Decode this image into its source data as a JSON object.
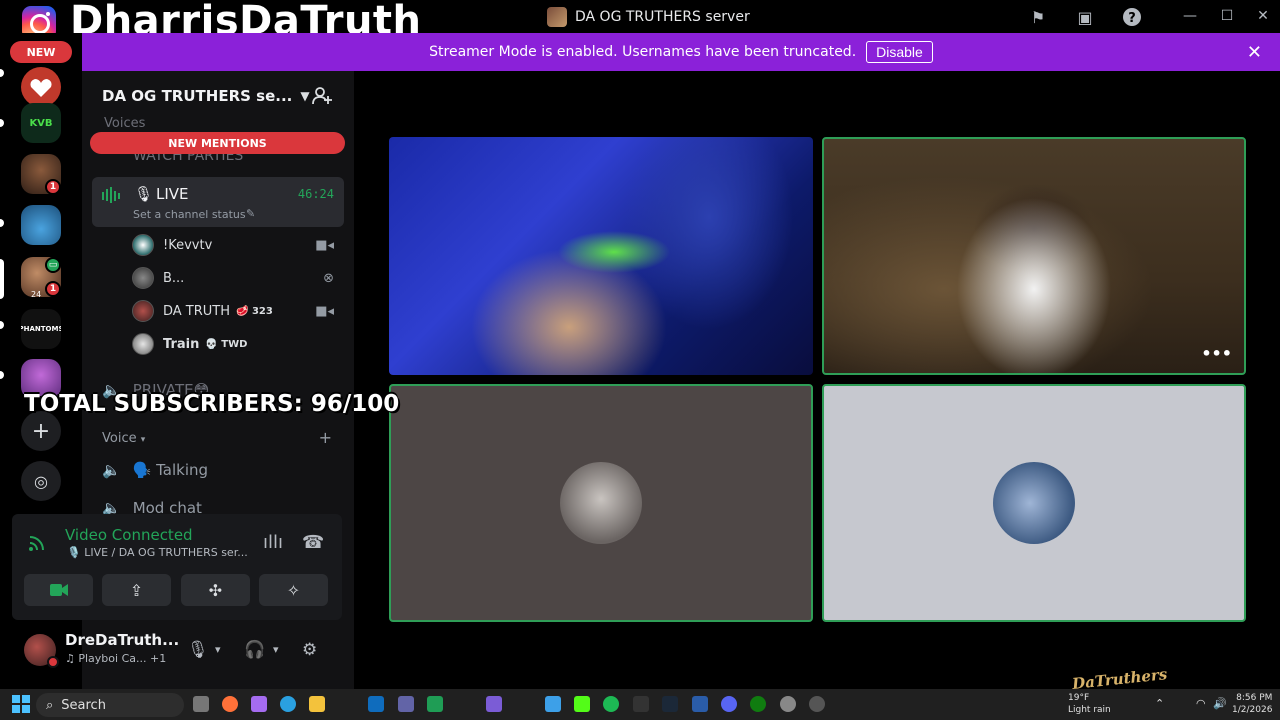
{
  "overlay": {
    "instagram_handle": "DharrisDaTruth",
    "subscribers_text": "TOTAL SUBSCRIBERS: 96/100",
    "watermark_text": "DaTruthers"
  },
  "window": {
    "server_title": "DA OG TRUTHERS server"
  },
  "banner": {
    "message": "Streamer Mode is enabled. Usernames have been truncated.",
    "disable_label": "Disable",
    "color": "#8b21d9"
  },
  "rail": {
    "new_label": "NEW",
    "badges": [
      "1",
      "1"
    ],
    "mutual_count": "24"
  },
  "sidebar": {
    "guild_name": "DA OG TRUTHERS se...",
    "faded_category": "Voices",
    "faded_channel": "WATCH PARTIES",
    "new_mentions": "NEW MENTIONS",
    "live_channel": {
      "name": "LIVE",
      "timer": "46:24",
      "status": "Set a channel status"
    },
    "voice_users": [
      {
        "name": "!Kevvtv",
        "tag": "",
        "activity_icon": "camera-icon"
      },
      {
        "name": "B...",
        "tag": "",
        "activity_icon": "xbox-icon"
      },
      {
        "name": "DA TRUTH",
        "tag": "🥩 323",
        "activity_icon": "camera-icon"
      },
      {
        "name": "Train",
        "tag": "💀 TWD",
        "activity_icon": ""
      }
    ],
    "private_channel": "PRIVATE😳",
    "voice_category": "Voice",
    "talking_channel": "🗣️ Talking",
    "modchat_channel": "Mod chat"
  },
  "voice_panel": {
    "title": "Video Connected",
    "subtitle": "🎙️ LIVE / DA OG TRUTHERS ser...",
    "status_color": "#23a559"
  },
  "user_panel": {
    "name": "DreDaTruth...",
    "activity": "♫ Playboi Ca... +1"
  },
  "taskbar": {
    "search_label": "Search",
    "weather_temp": "19°F",
    "weather_desc": "Light rain",
    "time": "8:56 PM",
    "date": "1/2/2026"
  }
}
